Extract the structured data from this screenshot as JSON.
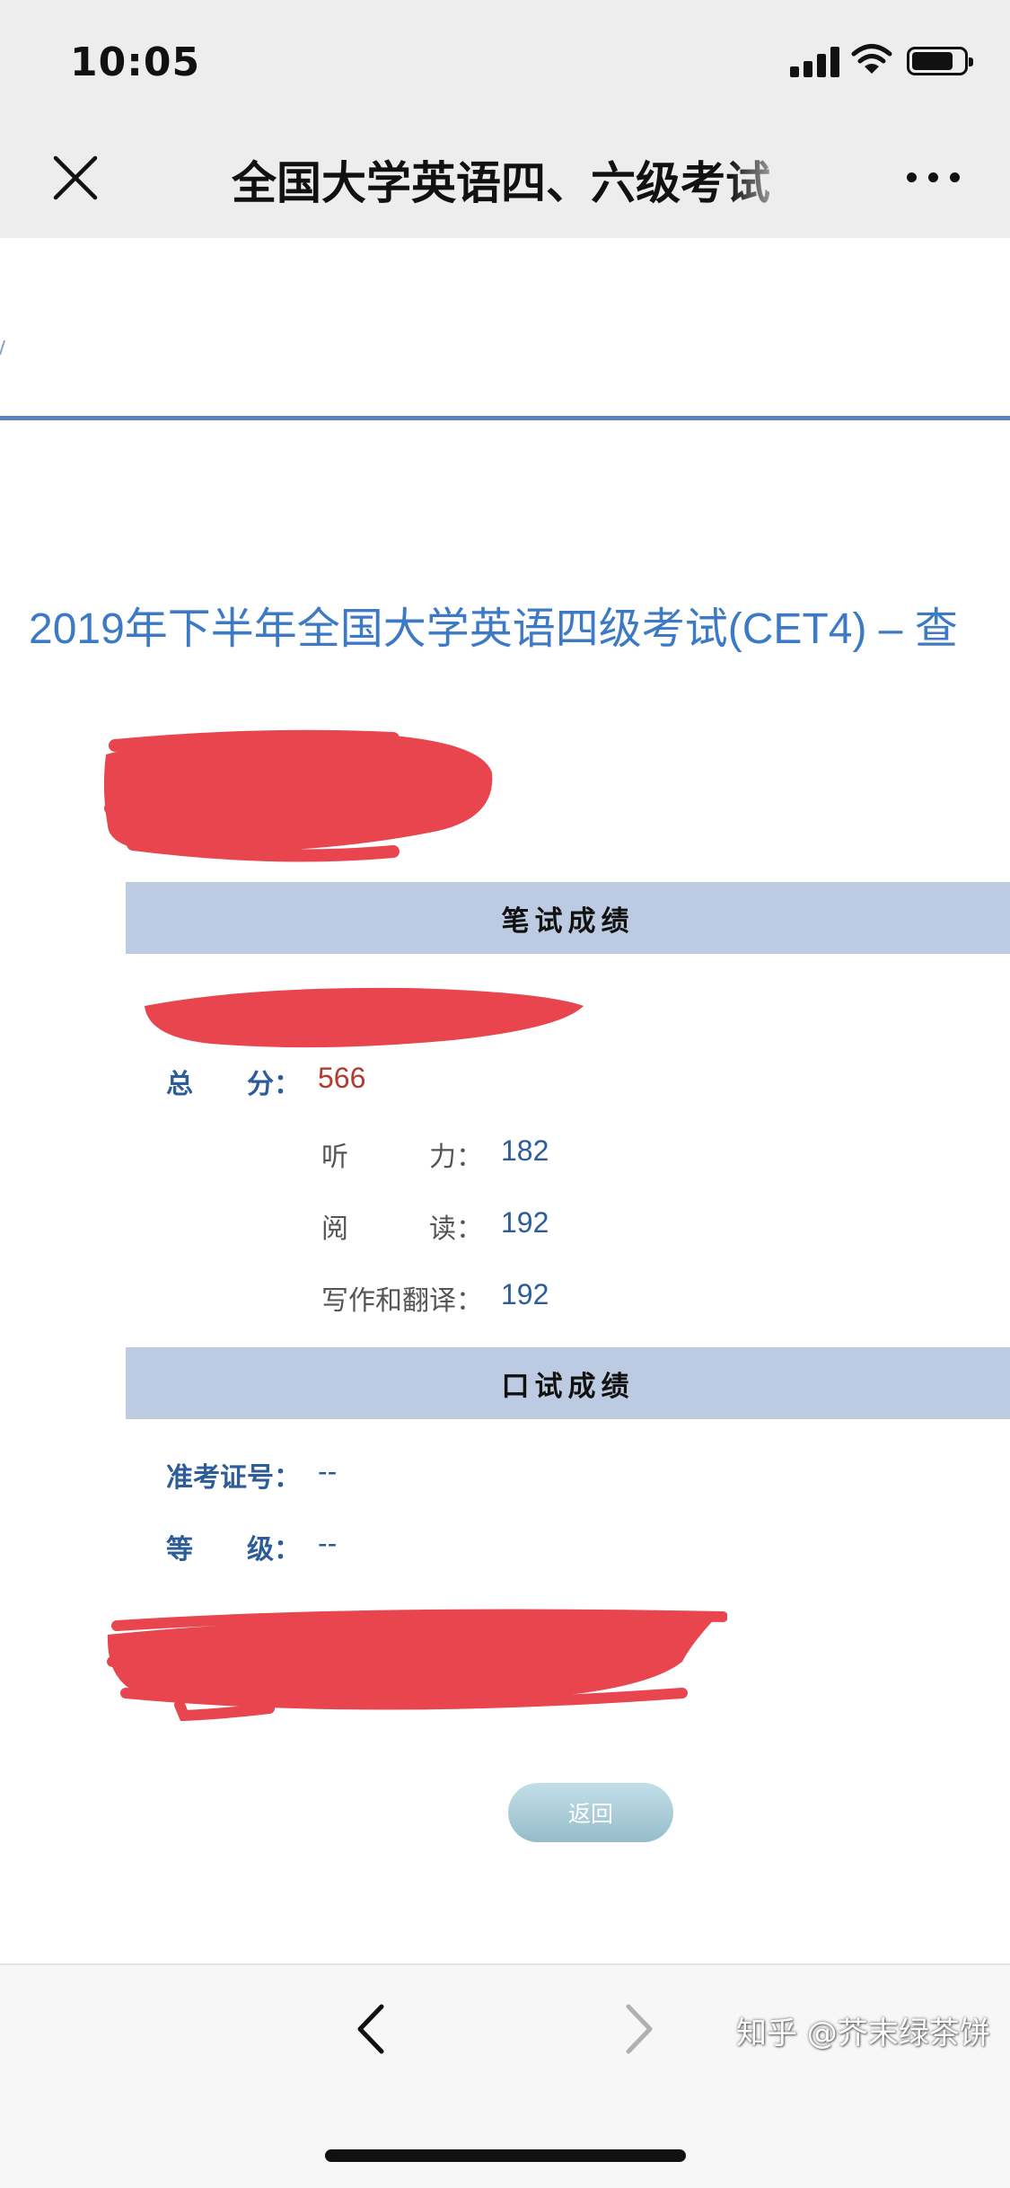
{
  "status_bar": {
    "time": "10:05",
    "battery_level": 0.8
  },
  "nav_bar": {
    "title": "全国大学英语四、六级考试",
    "close_icon": "close-icon",
    "more_icon": "more-icon"
  },
  "page": {
    "title": "2019年下半年全国大学英语四级考试(CET4) – 查",
    "written_section": {
      "heading": "笔试成绩",
      "total_label": "总　　分：",
      "total_value": "566",
      "items": [
        {
          "label": "听　　　力：",
          "value": "182"
        },
        {
          "label": "阅　　　读：",
          "value": "192"
        },
        {
          "label": "写作和翻译：",
          "value": "192"
        }
      ]
    },
    "oral_section": {
      "heading": "口试成绩",
      "exam_id_label": "准考证号：",
      "exam_id_value": "--",
      "grade_label": "等　　级：",
      "grade_value": "--"
    },
    "back_button_label": "返回"
  },
  "bottom_bar": {
    "back_icon": "chevron-left-icon",
    "forward_icon": "chevron-right-icon"
  },
  "watermark": "知乎 @芥末绿茶饼",
  "colors": {
    "title_blue": "#3c7ac6",
    "label_blue": "#2c5d99",
    "total_red": "#b13b2f",
    "section_bar": "#bccbe1",
    "redaction": "#e8454e"
  }
}
